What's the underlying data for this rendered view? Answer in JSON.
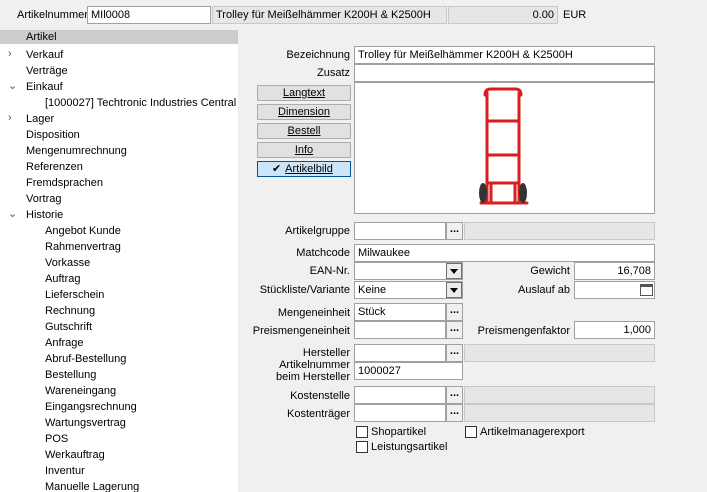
{
  "header": {
    "label": "Artikelnummer",
    "article_number": "MIl0008",
    "title": "Trolley für Meißelhämmer K200H & K2500H",
    "price": "0.00",
    "currency": "EUR"
  },
  "tree": {
    "artikel": "Artikel",
    "verkauf": "Verkauf",
    "vertraege": "Verträge",
    "einkauf": "Einkauf",
    "supplier": "[1000027]  Techtronic Industries Central",
    "lager": "Lager",
    "disposition": "Disposition",
    "mengenumrechnung": "Mengenumrechnung",
    "referenzen": "Referenzen",
    "fremdsprachen": "Fremdsprachen",
    "vortrag": "Vortrag",
    "historie": "Historie",
    "history_items": [
      "Angebot Kunde",
      "Rahmenvertrag",
      "Vorkasse",
      "Auftrag",
      "Lieferschein",
      "Rechnung",
      "Gutschrift",
      "Anfrage",
      "Abruf-Bestellung",
      "Bestellung",
      "Wareneingang",
      "Eingangsrechnung",
      "Wartungsvertrag",
      "POS",
      "Werkauftrag",
      "Inventur",
      "Manuelle Lagerung"
    ]
  },
  "buttons": {
    "langtext": "Langtext",
    "dimension": "Dimension",
    "bestell": "Bestell",
    "info": "Info",
    "artikelbild": "Artikelbild",
    "ellipsis": "..."
  },
  "form": {
    "bezeichnung_label": "Bezeichnung",
    "bezeichnung": "Trolley für Meißelhämmer K200H & K2500H",
    "zusatz_label": "Zusatz",
    "zusatz": "",
    "artikelgruppe_label": "Artikelgruppe",
    "artikelgruppe": "",
    "matchcode_label": "Matchcode",
    "matchcode": "Milwaukee",
    "ean_label": "EAN-Nr.",
    "ean": "",
    "gewicht_label": "Gewicht",
    "gewicht": "16,708",
    "stueckliste_label": "Stückliste/Variante",
    "stueckliste": "Keine",
    "auslauf_label": "Auslauf ab",
    "auslauf": "",
    "mengeneinheit_label": "Mengeneinheit",
    "mengeneinheit": "Stück",
    "preismengeneinheit_label": "Preismengeneinheit",
    "preismengeneinheit": "",
    "preismengenfaktor_label": "Preismengenfaktor",
    "preismengenfaktor": "1,000",
    "hersteller_label": "Hersteller",
    "hersteller": "",
    "artnr_hersteller_label_1": "Artikelnummer",
    "artnr_hersteller_label_2": "beim Hersteller",
    "artnr_hersteller": "1000027",
    "kostenstelle_label": "Kostenstelle",
    "kostenstelle": "",
    "kostentraeger_label": "Kostenträger",
    "kostentraeger": "",
    "shopartikel_label": "Shopartikel",
    "leistungsartikel_label": "Leistungsartikel",
    "artikelmanagerexport_label": "Artikelmanagerexport"
  },
  "colors": {
    "trolley_red": "#d81e1e",
    "selected_tree": "#cccccc",
    "active_button": "#cce4f7"
  }
}
